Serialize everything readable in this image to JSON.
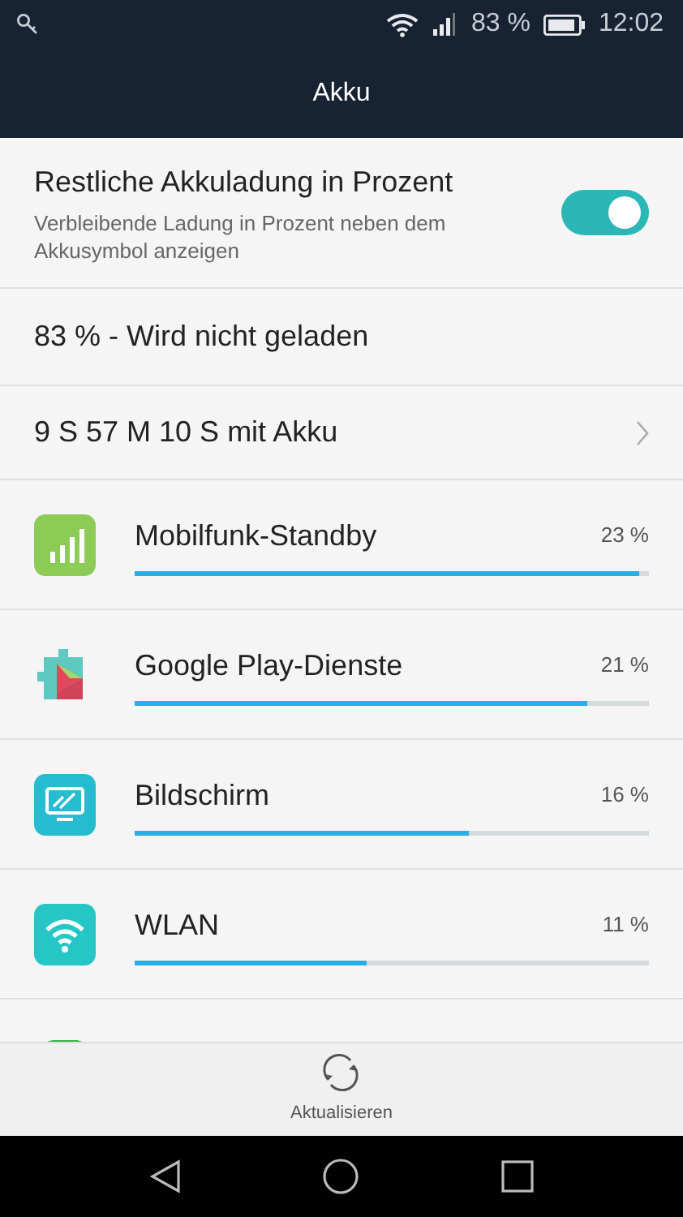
{
  "status_bar": {
    "battery_text": "83 %",
    "time": "12:02"
  },
  "header": {
    "title": "Akku"
  },
  "percent_setting": {
    "title": "Restliche Akkuladung in Prozent",
    "description": "Verbleibende Ladung in Prozent neben dem Akkusymbol anzeigen",
    "on": true
  },
  "charge_status": "83 % - Wird nicht geladen",
  "battery_time": "9 S 57 M 10 S mit Akku",
  "usage": [
    {
      "kind": "cellular",
      "name": "Mobilfunk-Standby",
      "percent": "23 %",
      "level": 0.98
    },
    {
      "kind": "play-services",
      "name": "Google Play-Dienste",
      "percent": "21 %",
      "level": 0.88
    },
    {
      "kind": "screen",
      "name": "Bildschirm",
      "percent": "16 %",
      "level": 0.65
    },
    {
      "kind": "wifi",
      "name": "WLAN",
      "percent": "11 %",
      "level": 0.45
    }
  ],
  "bottom_action": {
    "label": "Aktualisieren"
  }
}
